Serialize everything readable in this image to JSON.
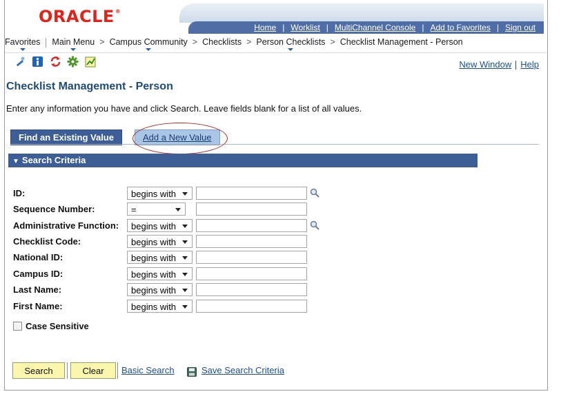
{
  "header": {
    "logo": "ORACLE",
    "links": [
      "Home",
      "Worklist",
      "MultiChannel Console",
      "Add to Favorites",
      "Sign out"
    ]
  },
  "breadcrumb": {
    "favorites": "Favorites",
    "main_menu": "Main Menu",
    "items": [
      "Campus Community",
      "Checklists",
      "Person Checklists",
      "Checklist Management - Person"
    ],
    "separator": ">"
  },
  "toolbar": {
    "icons": [
      "wand-icon",
      "info-icon",
      "refresh-icon",
      "gear-icon",
      "chart-icon"
    ],
    "new_window": "New Window",
    "help": "Help"
  },
  "page": {
    "title": "Checklist Management - Person",
    "instructions": "Enter any information you have and click Search. Leave fields blank for a list of all values."
  },
  "tabs": {
    "find": "Find an Existing Value",
    "add": "Add a New Value"
  },
  "search": {
    "section_title": "Search Criteria",
    "fields": [
      {
        "label": "ID:",
        "operator": "begins with",
        "lookup": true
      },
      {
        "label": "Sequence Number:",
        "operator": "=",
        "lookup": false
      },
      {
        "label": "Administrative Function:",
        "operator": "begins with",
        "lookup": true
      },
      {
        "label": "Checklist Code:",
        "operator": "begins with",
        "lookup": false
      },
      {
        "label": "National ID:",
        "operator": "begins with",
        "lookup": false
      },
      {
        "label": "Campus ID:",
        "operator": "begins with",
        "lookup": false
      },
      {
        "label": "Last Name:",
        "operator": "begins with",
        "lookup": false
      },
      {
        "label": "First Name:",
        "operator": "begins with",
        "lookup": false
      }
    ],
    "case_sensitive": "Case Sensitive"
  },
  "actions": {
    "search": "Search",
    "clear": "Clear",
    "basic_search": "Basic Search",
    "save_criteria": "Save Search Criteria"
  },
  "colors": {
    "brand_red": "#e2231a",
    "header_blue": "#4f6ea7",
    "tab_active": "#3c5d95",
    "tab_inactive": "#a9c6e4",
    "button_yellow": "#fbf6ad",
    "link_blue": "#1a4fa0"
  }
}
